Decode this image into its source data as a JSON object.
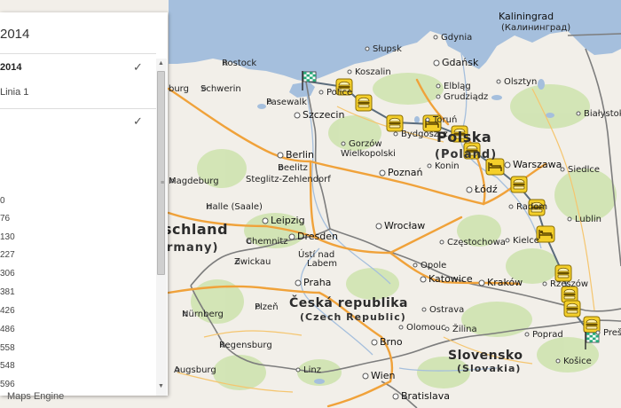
{
  "panel": {
    "title": "2014",
    "layers": [
      {
        "name": "2014",
        "checked": true
      },
      {
        "name": "Linia 1"
      },
      {
        "name": "",
        "checked": true
      }
    ],
    "numbers": [
      "0",
      "76",
      "130",
      "227",
      "306",
      "381",
      "426",
      "486",
      "558",
      "548",
      "596"
    ]
  },
  "brand": "Maps Engine",
  "map": {
    "countries": [
      {
        "name": "Polska",
        "sub": "(Poland)"
      },
      {
        "name": "schland",
        "sub": "rmany)"
      },
      {
        "name": "Česká republika",
        "sub": "(Czech Republic)"
      },
      {
        "name": "Slovensko",
        "sub": "(Slovakia)"
      }
    ],
    "cities": [
      "Kaliningrad",
      "(Калининград)",
      "Gdynia",
      "Słupsk",
      "Gdańsk",
      "Koszalin",
      "Rostock",
      "Olsztyn",
      "Elbląg",
      "Schwerin",
      "burg",
      "Police",
      "Pasewalk",
      "Szczecin",
      "Grudziądz",
      "Toruń",
      "Bydgoszcz",
      "Gorzów",
      "Wielkopolski",
      "Berlin",
      "Beelitz",
      "Steglitz-Zehlendorf",
      "Magdeburg",
      "Poznań",
      "Konin",
      "Warszawa",
      "Siedlce",
      "Białystok",
      "Łódź",
      "Radom",
      "Lublin",
      "Wrocław",
      "Częstochowa",
      "Kielce",
      "Halle (Saale)",
      "Leipzig",
      "Dresden",
      "Chemnitz",
      "Zwickau",
      "Ústí nad",
      "Labem",
      "Opole",
      "Katowice",
      "Kraków",
      "Rzeszów",
      "Praha",
      "Plzeň",
      "Ostrava",
      "Brno",
      "Žilina",
      "Nürnberg",
      "Augsburg",
      "Linz",
      "Wien",
      "Bratislava",
      "Poprad",
      "Košice",
      "Regensburg",
      "Prešov",
      "Olomouc"
    ],
    "route_markers": 14
  }
}
